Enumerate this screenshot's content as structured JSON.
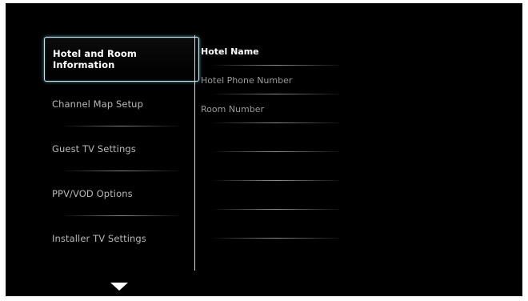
{
  "menu": {
    "items": [
      {
        "label": "Hotel and Room Information"
      },
      {
        "label": "Channel Map Setup"
      },
      {
        "label": "Guest TV Settings"
      },
      {
        "label": "PPV/VOD Options"
      },
      {
        "label": "Installer TV Settings"
      }
    ],
    "selected_index": 0
  },
  "submenu": {
    "items": [
      {
        "label": "Hotel Name"
      },
      {
        "label": "Hotel Phone Number"
      },
      {
        "label": "Room Number"
      },
      {
        "label": ""
      },
      {
        "label": ""
      },
      {
        "label": ""
      },
      {
        "label": ""
      }
    ],
    "active_index": 0
  },
  "icons": {
    "scroll_down": "down-arrow-icon"
  },
  "colors": {
    "background": "#000000",
    "selection_border": "#bfe8f5",
    "text_active": "#ffffff",
    "text_inactive": "#b8b8b8"
  }
}
